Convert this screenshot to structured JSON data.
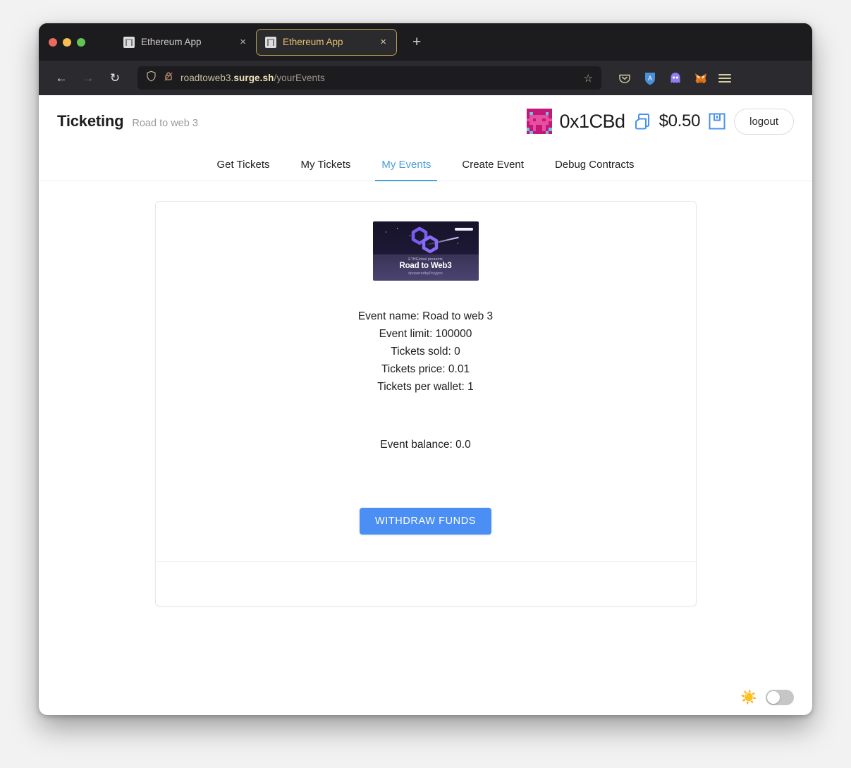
{
  "browser": {
    "traffic_lights": [
      "close",
      "minimize",
      "zoom"
    ],
    "tabs": [
      {
        "title": "Ethereum App",
        "active": false,
        "close_label": "×"
      },
      {
        "title": "Ethereum App",
        "active": true,
        "close_label": "×"
      }
    ],
    "new_tab_label": "+",
    "back_label": "←",
    "forward_label": "→",
    "reload_label": "↻",
    "url": {
      "prefix": "roadtoweb3.",
      "domain": "surge.sh",
      "path": "/yourEvents"
    },
    "bookmark_label": "☆",
    "extensions": [
      "pocket-icon",
      "shield-extension-icon",
      "ghost-extension-icon",
      "metamask-fox-icon",
      "menu-icon"
    ]
  },
  "app": {
    "brand_title": "Ticketing",
    "brand_subtitle": "Road to web 3",
    "account": {
      "address": "0x1CBd",
      "balance_usd": "$0.50",
      "copy_icon": "copy-icon",
      "save_icon": "save-icon",
      "logout_label": "logout"
    },
    "nav_tabs": [
      {
        "label": "Get Tickets",
        "active": false
      },
      {
        "label": "My Tickets",
        "active": false
      },
      {
        "label": "My Events",
        "active": true
      },
      {
        "label": "Create Event",
        "active": false
      },
      {
        "label": "Debug Contracts",
        "active": false
      }
    ],
    "event_card": {
      "image": {
        "presenter": "ETHGlobal presents",
        "title": "Road to Web3",
        "hashtag": "#poweredbyPolygon"
      },
      "details": [
        "Event name: Road to web 3",
        "Event limit: 100000",
        "Tickets sold: 0",
        "Tickets price: 0.01",
        "Tickets per wallet: 1"
      ],
      "balance_line": "Event balance: 0.0",
      "withdraw_label": "WITHDRAW FUNDS"
    },
    "theme": {
      "sun_icon": "☀️",
      "toggle_state": "off"
    }
  },
  "colors": {
    "accent_blue": "#4b8ef4",
    "active_tab_blue": "#4a9ed6",
    "browser_chrome": "#1c1b1e",
    "url_gold": "#f0e2b6"
  }
}
